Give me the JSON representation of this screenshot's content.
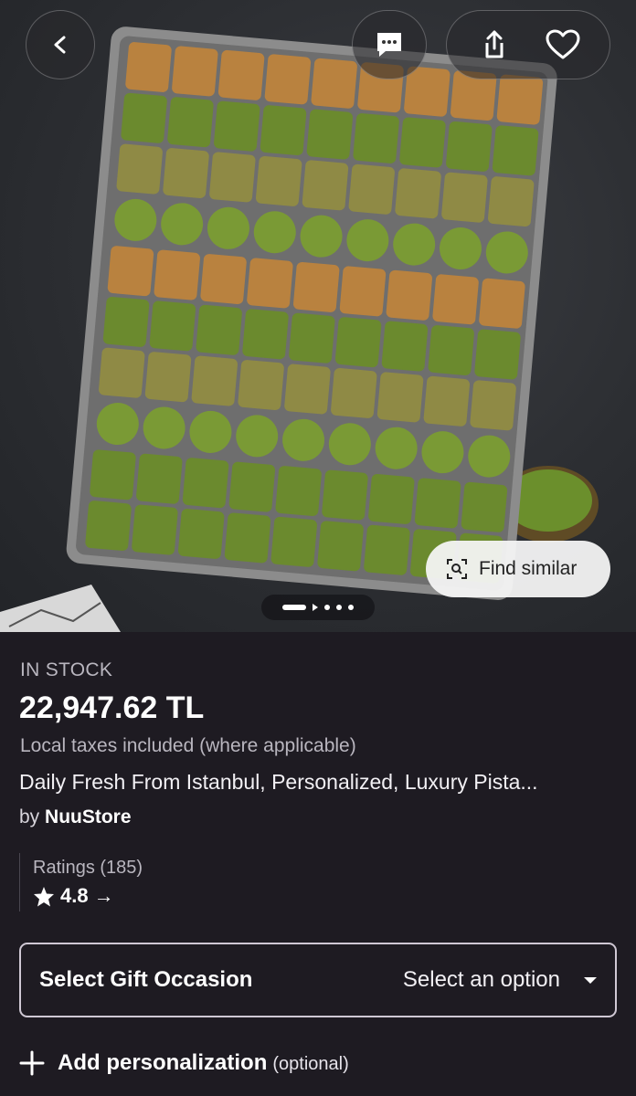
{
  "header": {
    "back_icon": "chevron-left-icon",
    "message_icon": "message-dots-icon",
    "share_icon": "share-icon",
    "favorite_icon": "heart-icon"
  },
  "gallery": {
    "image_subject": "tray of pistachio baklava",
    "find_similar_label": "Find similar",
    "page_dots": 4,
    "active_index": 0
  },
  "product": {
    "stock_status": "IN STOCK",
    "price": "22,947.62 TL",
    "tax_note": "Local taxes included (where applicable)",
    "title": "Daily Fresh From Istanbul, Personalized, Luxury Pista...",
    "by_prefix": "by",
    "shop_name": "NuuStore"
  },
  "ratings": {
    "label": "Ratings (185)",
    "value": "4.8",
    "arrow": "→"
  },
  "gift_occasion": {
    "label": "Select Gift Occasion",
    "value": "Select an option"
  },
  "personalization": {
    "label": "Add personalization",
    "optional": "(optional)"
  },
  "colors": {
    "background": "#1e1b22",
    "pistachio": "#6b8a2e",
    "pastry": "#b9823f"
  }
}
